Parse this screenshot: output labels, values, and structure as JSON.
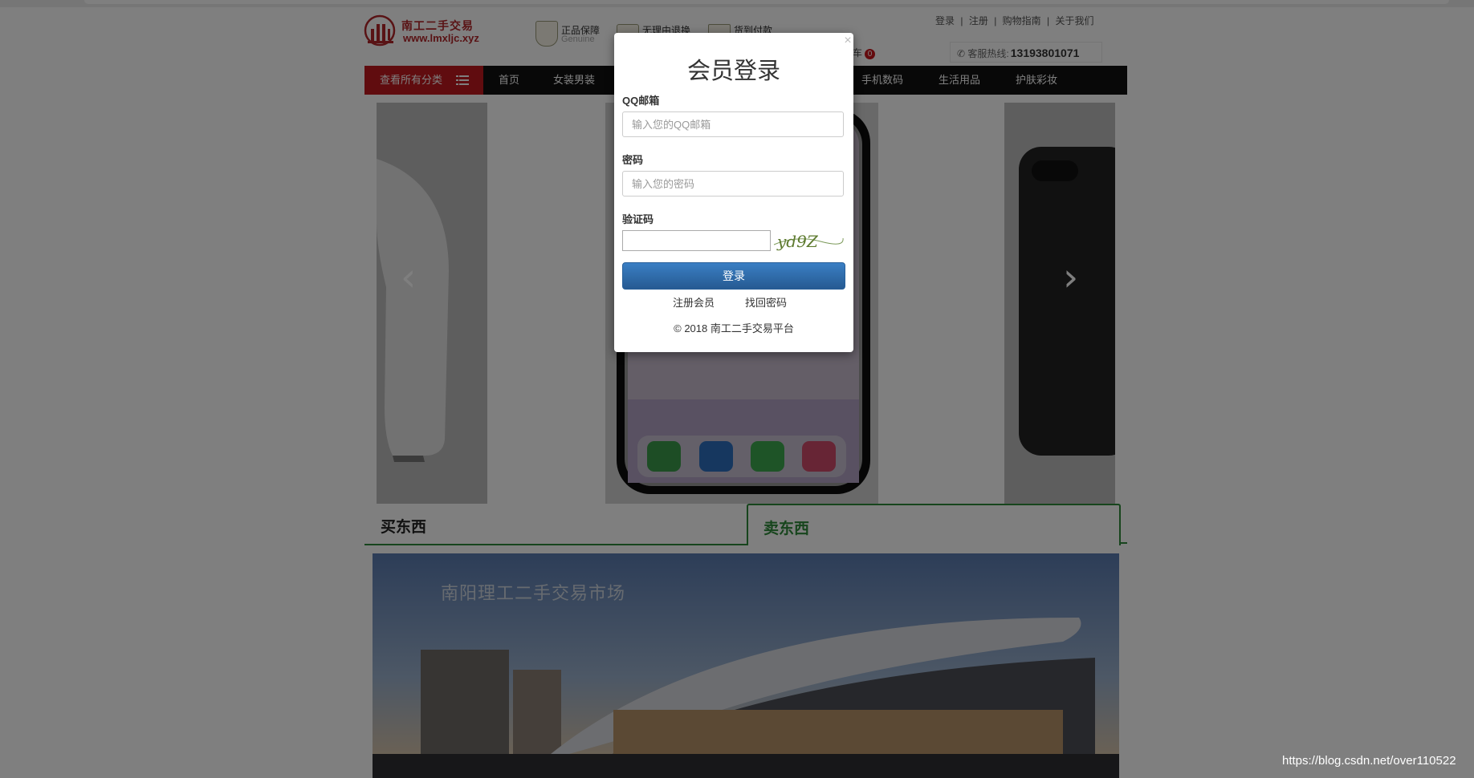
{
  "header": {
    "logo_text": "南工二手交易",
    "logo_url": "www.lmxljc.xyz",
    "features": [
      {
        "title": "正品保障",
        "subtitle": "Genuine"
      },
      {
        "title": "无理由退换",
        "subtitle": ""
      },
      {
        "title": "货到付款",
        "subtitle": ""
      }
    ],
    "top_links": [
      "登录",
      "|",
      "注册",
      "|",
      "购物指南",
      "|",
      "关于我们"
    ],
    "cart_label": "车",
    "cart_count": "0",
    "hotline_label": "客服热线:",
    "hotline_number": "13193801071"
  },
  "nav": {
    "all_categories": "查看所有分类",
    "items": [
      "首页",
      "女装男装",
      "手机数码",
      "生活用品",
      "护肤彩妆"
    ]
  },
  "carousel": {
    "prev_arrow": "‹",
    "next_arrow": "›"
  },
  "tabs": {
    "buy": "买东西",
    "sell": "卖东西"
  },
  "banner": {
    "title": "南阳理工二手交易市场"
  },
  "modal": {
    "close": "×",
    "title": "会员登录",
    "email_label": "QQ邮箱",
    "email_placeholder": "输入您的QQ邮箱",
    "email_value": "",
    "password_label": "密码",
    "password_placeholder": "输入您的密码",
    "password_value": "",
    "captcha_label": "验证码",
    "captcha_value": "",
    "captcha_text": "yd9Z",
    "login_button": "登录",
    "register_link": "注册会员",
    "forgot_link": "找回密码",
    "footer": "© 2018 南工二手交易平台"
  },
  "watermark": "https://blog.csdn.net/over110522",
  "colors": {
    "brand_red": "#c0191f",
    "nav_black": "#111111",
    "tab_green": "#2f8a3a",
    "button_blue": "#2d6db0"
  }
}
